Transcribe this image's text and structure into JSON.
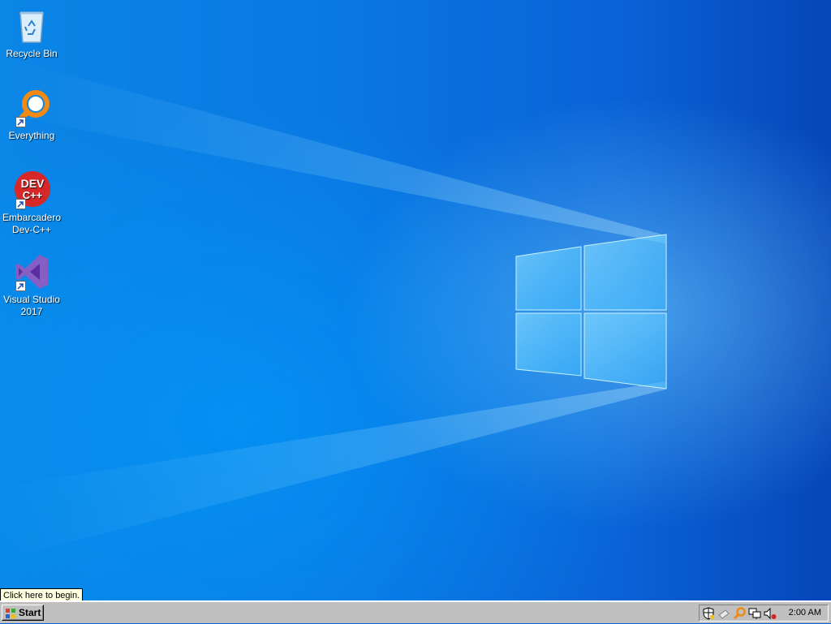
{
  "desktop": {
    "icons": [
      {
        "label": "Recycle Bin",
        "icon": "recycle-bin-icon"
      },
      {
        "label": "Everything",
        "icon": "everything-search-icon"
      },
      {
        "label": "Embarcadero\nDev-C++",
        "icon": "devcpp-icon",
        "logo_text_1": "DEV",
        "logo_text_2": "C++"
      },
      {
        "label": "Visual Studio\n2017",
        "icon": "visual-studio-icon"
      }
    ]
  },
  "tooltip": {
    "text": "Click here to begin."
  },
  "taskbar": {
    "start_label": "Start",
    "clock": "2:00 AM",
    "tray_icons": [
      "security-shield-icon",
      "network-drive-icon",
      "everything-tray-icon",
      "network-icon",
      "volume-muted-icon"
    ]
  },
  "colors": {
    "taskbar": "#c0c0c0",
    "desktop_accent": "#0a78e2",
    "tooltip_bg": "#ffffe1"
  }
}
